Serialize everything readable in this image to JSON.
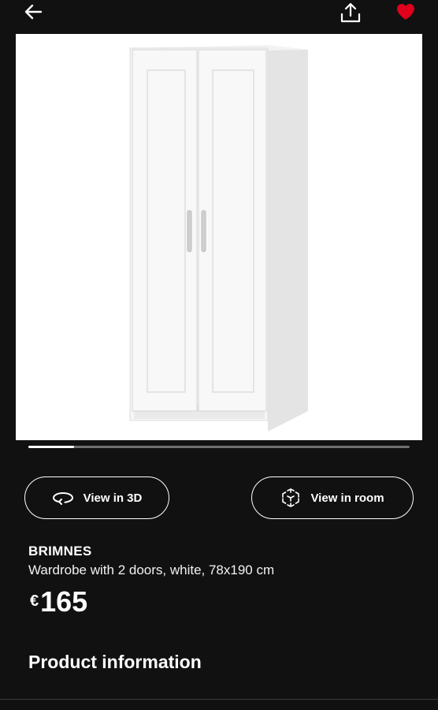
{
  "topbar": {
    "back_icon": "arrow-left-icon",
    "share_icon": "share-icon",
    "favorite_icon": "heart-icon",
    "favorite_color": "#e0001b"
  },
  "gallery": {
    "image_subject": "white two-door wardrobe",
    "progress": 0.12
  },
  "buttons": {
    "view_3d": {
      "label": "View in 3D",
      "icon": "rotate-3d-icon"
    },
    "view_room": {
      "label": "View in room",
      "icon": "ar-cube-icon"
    }
  },
  "product": {
    "name": "BRIMNES",
    "description": "Wardrobe with 2 doors, white, 78x190 cm",
    "currency": "€",
    "price": "165"
  },
  "sections": {
    "product_information": "Product information"
  }
}
